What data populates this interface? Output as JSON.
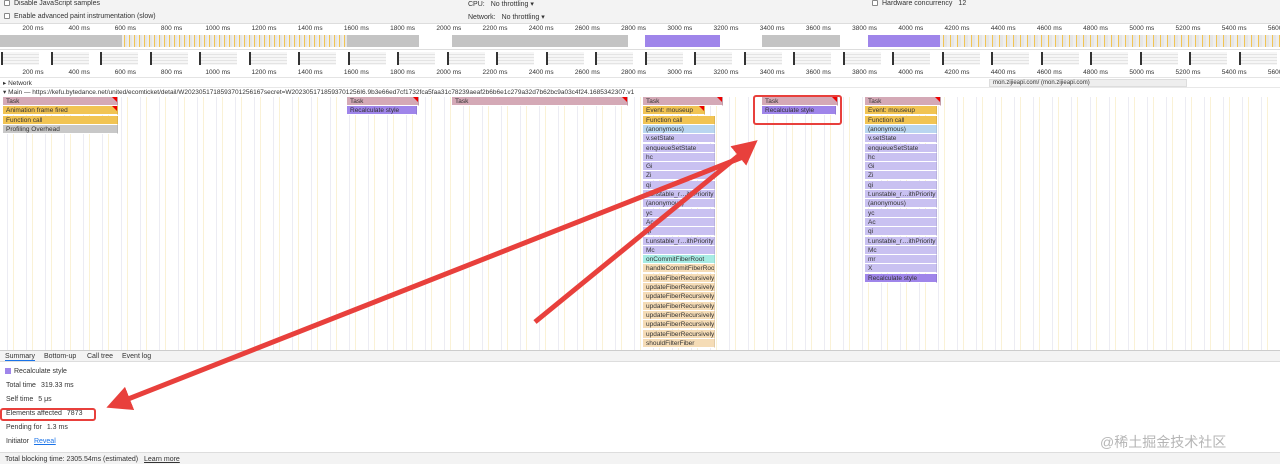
{
  "settings": {
    "disable_js_samples": "Disable JavaScript samples",
    "advanced_paint": "Enable advanced paint instrumentation (slow)",
    "cpu_label": "CPU:",
    "cpu_value": "No throttling",
    "network_label": "Network:",
    "network_value": "No throttling",
    "hw_label": "Hardware concurrency",
    "hw_value": "12"
  },
  "ticks": [
    "200 ms",
    "400 ms",
    "600 ms",
    "800 ms",
    "1000 ms",
    "1200 ms",
    "1400 ms",
    "1600 ms",
    "1800 ms",
    "2000 ms",
    "2200 ms",
    "2400 ms",
    "2600 ms",
    "2800 ms",
    "3000 ms",
    "3200 ms",
    "3400 ms",
    "3600 ms",
    "3800 ms",
    "4000 ms",
    "4200 ms",
    "4400 ms",
    "4600 ms",
    "4800 ms",
    "5000 ms",
    "5200 ms",
    "5400 ms",
    "5600 ms"
  ],
  "network": {
    "label": "Network",
    "request": "mon.zijieapi.com/ (mon.zijieapi.com)"
  },
  "main": {
    "label": "Main — https://kefu.bytedance.net/united/ecomticket/detail/W2023051718593701256167secret=W2023051718593701256I6.9b3e66ed7cf1732fca5faa31c78239aeaf2b6b6e1c279a32d7b62bc9a03c4f24.1685342307.v1"
  },
  "flame": {
    "col1": [
      {
        "label": "Task",
        "kind": "task"
      },
      {
        "label": "Animation frame fired",
        "kind": "event"
      },
      {
        "label": "Function call",
        "kind": "func"
      },
      {
        "label": "Profiling Overhead",
        "kind": "overhead"
      }
    ],
    "col2": [
      {
        "label": "Task",
        "kind": "task"
      },
      {
        "label": "Recalculate style",
        "kind": "style"
      }
    ],
    "col3": [
      {
        "label": "Task",
        "kind": "task"
      }
    ],
    "col4": [
      {
        "label": "Task",
        "kind": "task"
      },
      {
        "label": "Event: mouseup",
        "kind": "event"
      },
      {
        "label": "Function call",
        "kind": "func"
      },
      {
        "label": "(anonymous)",
        "kind": "anon"
      },
      {
        "label": "v.setState",
        "kind": "js"
      },
      {
        "label": "enqueueSetState",
        "kind": "js"
      },
      {
        "label": "hc",
        "kind": "js"
      },
      {
        "label": "Gi",
        "kind": "js"
      },
      {
        "label": "Zi",
        "kind": "js"
      },
      {
        "label": "qi",
        "kind": "js"
      },
      {
        "label": "t.unstable_r…ithPriority",
        "kind": "js"
      },
      {
        "label": "(anonymous)",
        "kind": "js"
      },
      {
        "label": "yc",
        "kind": "js"
      },
      {
        "label": "Ac",
        "kind": "js"
      },
      {
        "label": "qi",
        "kind": "js"
      },
      {
        "label": "t.unstable_r…ithPriority",
        "kind": "js"
      },
      {
        "label": "Mc",
        "kind": "js"
      },
      {
        "label": "onCommitFiberRoot",
        "kind": "react"
      },
      {
        "label": "handleCommitFiberRoot",
        "kind": "fiber"
      },
      {
        "label": "updateFiberRecursively",
        "kind": "fiber"
      },
      {
        "label": "updateFiberRecursively",
        "kind": "fiber"
      },
      {
        "label": "updateFiberRecursively",
        "kind": "fiber"
      },
      {
        "label": "updateFiberRecursively",
        "kind": "fiber"
      },
      {
        "label": "updateFiberRecursively",
        "kind": "fiber"
      },
      {
        "label": "updateFiberRecursively",
        "kind": "fiber"
      },
      {
        "label": "updateFiberRecursively",
        "kind": "fiber"
      },
      {
        "label": "shouldFilterFiber",
        "kind": "fiber"
      }
    ],
    "col5": [
      {
        "label": "Task",
        "kind": "task"
      },
      {
        "label": "Recalculate style",
        "kind": "style"
      }
    ],
    "col6": [
      {
        "label": "Task",
        "kind": "task"
      },
      {
        "label": "Event: mouseup",
        "kind": "event"
      },
      {
        "label": "Function call",
        "kind": "func"
      },
      {
        "label": "(anonymous)",
        "kind": "anon"
      },
      {
        "label": "v.setState",
        "kind": "js"
      },
      {
        "label": "enqueueSetState",
        "kind": "js"
      },
      {
        "label": "hc",
        "kind": "js"
      },
      {
        "label": "Gi",
        "kind": "js"
      },
      {
        "label": "Zi",
        "kind": "js"
      },
      {
        "label": "qi",
        "kind": "js"
      },
      {
        "label": "t.unstable_r…ithPriority",
        "kind": "js"
      },
      {
        "label": "(anonymous)",
        "kind": "js"
      },
      {
        "label": "yc",
        "kind": "js"
      },
      {
        "label": "Ac",
        "kind": "js"
      },
      {
        "label": "qi",
        "kind": "js"
      },
      {
        "label": "t.unstable_r…ithPriority",
        "kind": "js"
      },
      {
        "label": "Mc",
        "kind": "js"
      },
      {
        "label": "mr",
        "kind": "js"
      },
      {
        "label": "X",
        "kind": "js"
      },
      {
        "label": "Recalculate style",
        "kind": "style"
      }
    ]
  },
  "tabs": [
    "Summary",
    "Bottom-up",
    "Call tree",
    "Event log"
  ],
  "summary": {
    "title": "Recalculate style",
    "color": "#9f85ea",
    "total_time_label": "Total time",
    "total_time": "319.33 ms",
    "self_time_label": "Self time",
    "self_time": "5 μs",
    "elements_label": "Elements affected",
    "elements": "7873",
    "pending_label": "Pending for",
    "pending": "1.3 ms",
    "initiator_label": "Initiator",
    "initiator": "Reveal"
  },
  "footer": {
    "text": "Total blocking time: 2305.54ms (estimated)",
    "link": "Learn more"
  },
  "watermark": "@稀土掘金技术社区",
  "annotation_color": "#e8403c"
}
